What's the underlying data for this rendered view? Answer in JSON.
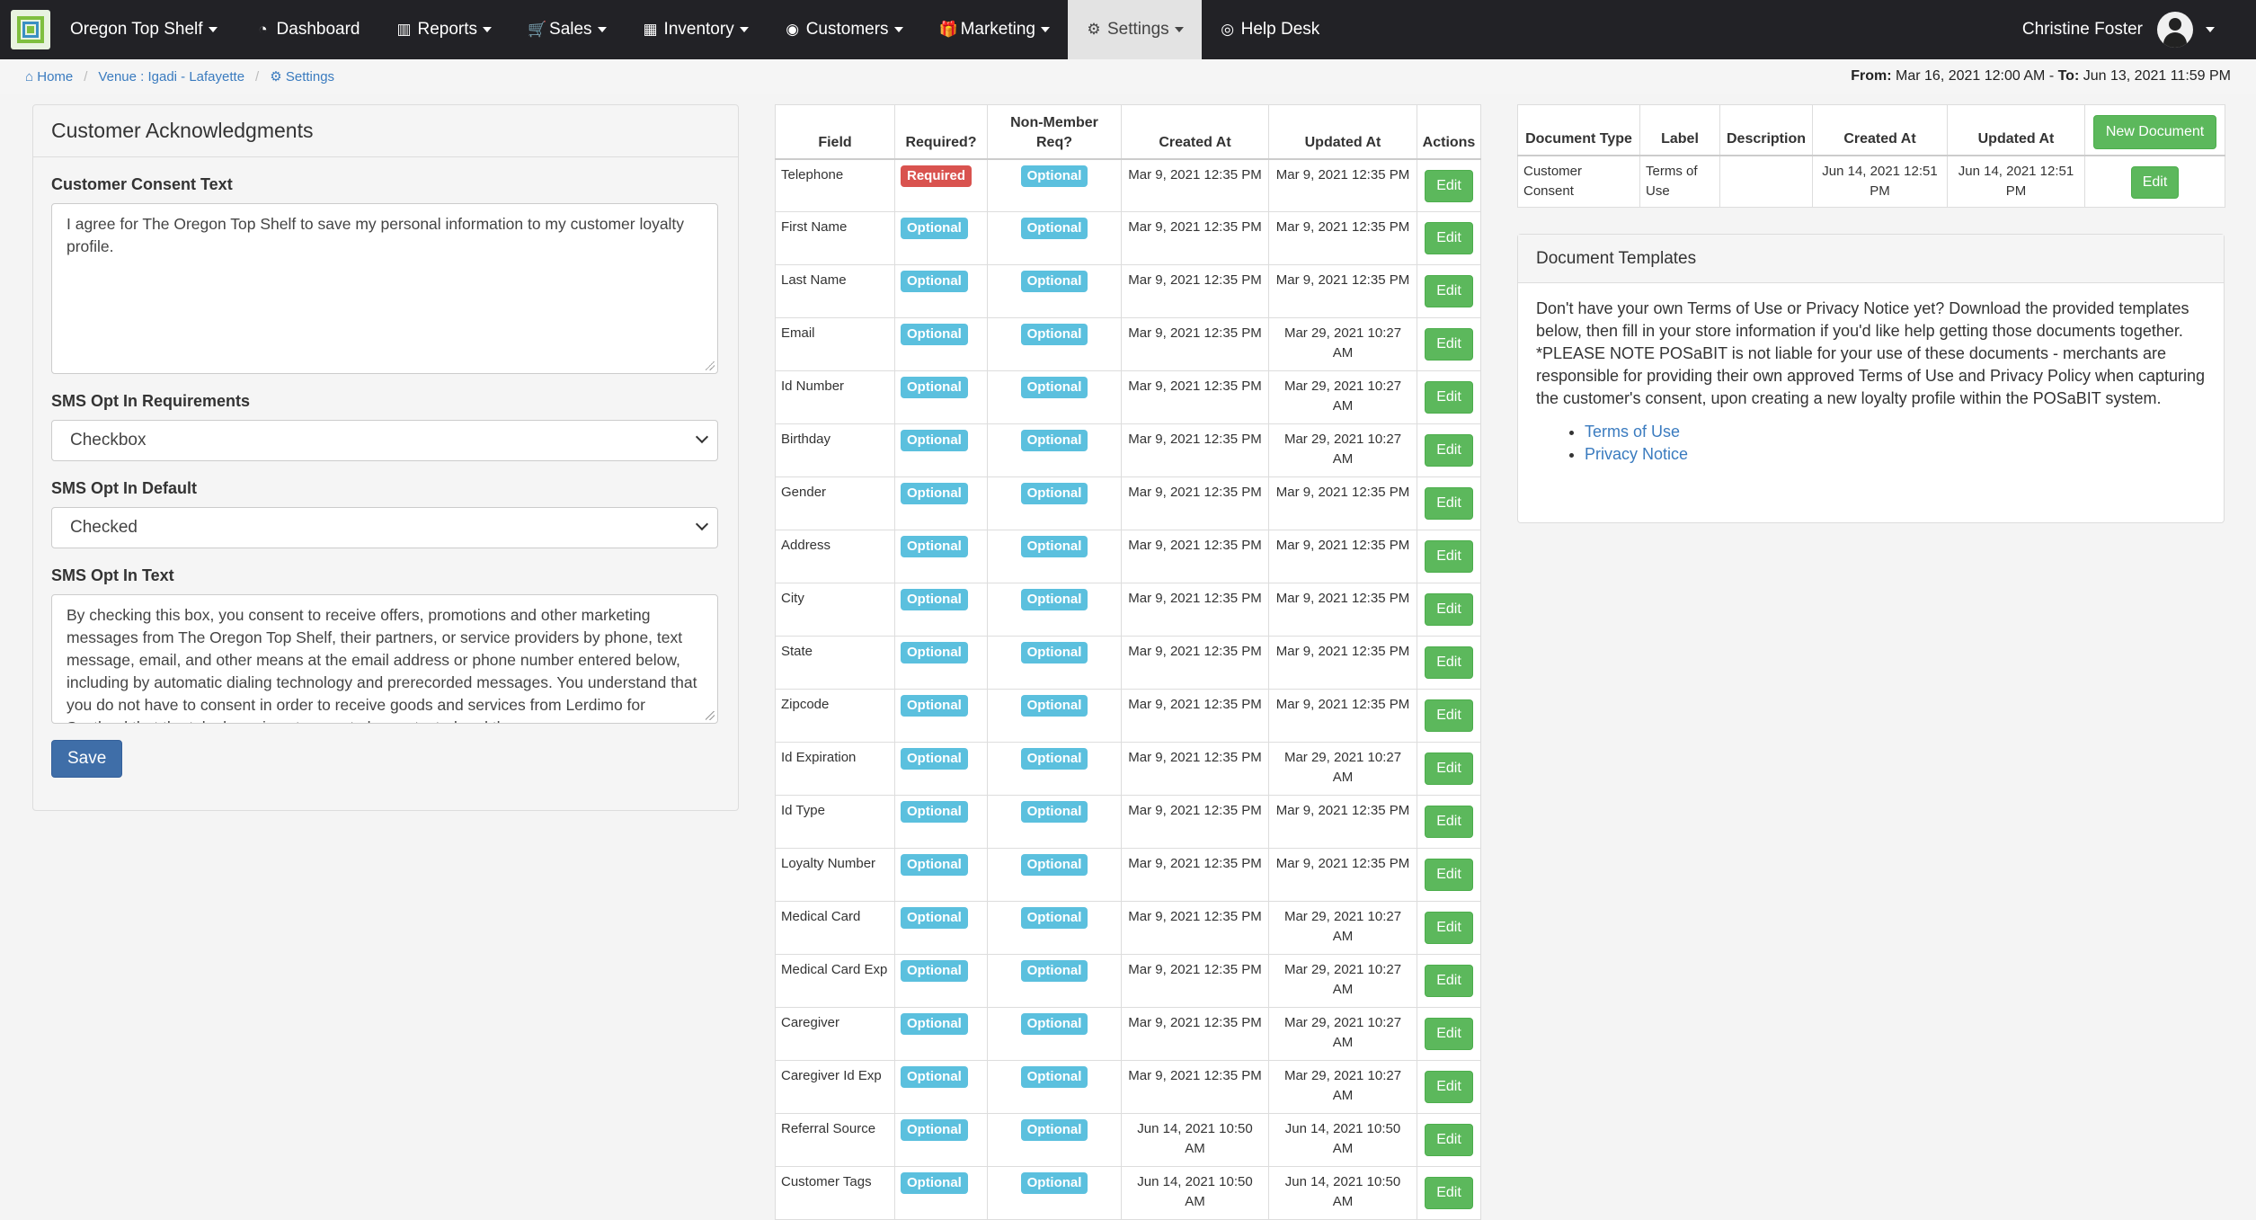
{
  "nav": {
    "brand": "Oregon Top Shelf",
    "items": [
      {
        "label": "Dashboard",
        "icon": "dashboard-icon",
        "glyph": "◔",
        "caret": false,
        "active": false
      },
      {
        "label": "Reports",
        "icon": "bar-chart-icon",
        "glyph": "▥",
        "caret": true,
        "active": false
      },
      {
        "label": "Sales",
        "icon": "cart-icon",
        "glyph": "🛒",
        "caret": true,
        "active": false
      },
      {
        "label": "Inventory",
        "icon": "grid-icon",
        "glyph": "▦",
        "caret": true,
        "active": false
      },
      {
        "label": "Customers",
        "icon": "user-circle-icon",
        "glyph": "◉",
        "caret": true,
        "active": false
      },
      {
        "label": "Marketing",
        "icon": "gift-icon",
        "glyph": "🎁",
        "caret": true,
        "active": false
      },
      {
        "label": "Settings",
        "icon": "cogs-icon",
        "glyph": "⚙",
        "caret": true,
        "active": true
      },
      {
        "label": "Help Desk",
        "icon": "life-ring-icon",
        "glyph": "◎",
        "caret": false,
        "active": false
      }
    ],
    "user": "Christine Foster"
  },
  "breadcrumb": {
    "home": "Home",
    "venue": "Venue : Igadi - Lafayette",
    "settings": "Settings"
  },
  "daterange": {
    "from_label": "From:",
    "from": "Mar 16, 2021 12:00 AM",
    "sep": "-",
    "to_label": "To:",
    "to": "Jun 13, 2021 11:59 PM"
  },
  "ack": {
    "title": "Customer Acknowledgments",
    "consent_label": "Customer Consent Text",
    "consent_text": "I agree for The Oregon Top Shelf to save my personal information to my customer loyalty profile.",
    "sms_req_label": "SMS Opt In Requirements",
    "sms_req_value": "Checkbox",
    "sms_default_label": "SMS Opt In Default",
    "sms_default_value": "Checked",
    "sms_text_label": "SMS Opt In Text",
    "sms_text": "By checking this box, you consent to receive offers, promotions and other marketing messages from The Oregon Top Shelf, their partners, or service providers by phone, text message, email, and other means at the email address or phone number entered below, including by automatic dialing technology and prerecorded messages. You understand that you do not have to consent in order to receive goods and services from Lerdimo for Scotland that the telephone is not a way to be contacted and the",
    "save_label": "Save"
  },
  "fields_table": {
    "headers": [
      "Field",
      "Required?",
      "Non-Member Req?",
      "Created At",
      "Updated At",
      "Actions"
    ],
    "edit_label": "Edit",
    "rows": [
      {
        "field": "Telephone",
        "required": "Required",
        "nonmember": "Optional",
        "created": "Mar 9, 2021 12:35 PM",
        "updated": "Mar 9, 2021 12:35 PM"
      },
      {
        "field": "First Name",
        "required": "Optional",
        "nonmember": "Optional",
        "created": "Mar 9, 2021 12:35 PM",
        "updated": "Mar 9, 2021 12:35 PM"
      },
      {
        "field": "Last Name",
        "required": "Optional",
        "nonmember": "Optional",
        "created": "Mar 9, 2021 12:35 PM",
        "updated": "Mar 9, 2021 12:35 PM"
      },
      {
        "field": "Email",
        "required": "Optional",
        "nonmember": "Optional",
        "created": "Mar 9, 2021 12:35 PM",
        "updated": "Mar 29, 2021 10:27 AM"
      },
      {
        "field": "Id Number",
        "required": "Optional",
        "nonmember": "Optional",
        "created": "Mar 9, 2021 12:35 PM",
        "updated": "Mar 29, 2021 10:27 AM"
      },
      {
        "field": "Birthday",
        "required": "Optional",
        "nonmember": "Optional",
        "created": "Mar 9, 2021 12:35 PM",
        "updated": "Mar 29, 2021 10:27 AM"
      },
      {
        "field": "Gender",
        "required": "Optional",
        "nonmember": "Optional",
        "created": "Mar 9, 2021 12:35 PM",
        "updated": "Mar 9, 2021 12:35 PM"
      },
      {
        "field": "Address",
        "required": "Optional",
        "nonmember": "Optional",
        "created": "Mar 9, 2021 12:35 PM",
        "updated": "Mar 9, 2021 12:35 PM"
      },
      {
        "field": "City",
        "required": "Optional",
        "nonmember": "Optional",
        "created": "Mar 9, 2021 12:35 PM",
        "updated": "Mar 9, 2021 12:35 PM"
      },
      {
        "field": "State",
        "required": "Optional",
        "nonmember": "Optional",
        "created": "Mar 9, 2021 12:35 PM",
        "updated": "Mar 9, 2021 12:35 PM"
      },
      {
        "field": "Zipcode",
        "required": "Optional",
        "nonmember": "Optional",
        "created": "Mar 9, 2021 12:35 PM",
        "updated": "Mar 9, 2021 12:35 PM"
      },
      {
        "field": "Id Expiration",
        "required": "Optional",
        "nonmember": "Optional",
        "created": "Mar 9, 2021 12:35 PM",
        "updated": "Mar 29, 2021 10:27 AM"
      },
      {
        "field": "Id Type",
        "required": "Optional",
        "nonmember": "Optional",
        "created": "Mar 9, 2021 12:35 PM",
        "updated": "Mar 9, 2021 12:35 PM"
      },
      {
        "field": "Loyalty Number",
        "required": "Optional",
        "nonmember": "Optional",
        "created": "Mar 9, 2021 12:35 PM",
        "updated": "Mar 9, 2021 12:35 PM"
      },
      {
        "field": "Medical Card",
        "required": "Optional",
        "nonmember": "Optional",
        "created": "Mar 9, 2021 12:35 PM",
        "updated": "Mar 29, 2021 10:27 AM"
      },
      {
        "field": "Medical Card Exp",
        "required": "Optional",
        "nonmember": "Optional",
        "created": "Mar 9, 2021 12:35 PM",
        "updated": "Mar 29, 2021 10:27 AM"
      },
      {
        "field": "Caregiver",
        "required": "Optional",
        "nonmember": "Optional",
        "created": "Mar 9, 2021 12:35 PM",
        "updated": "Mar 29, 2021 10:27 AM"
      },
      {
        "field": "Caregiver Id Exp",
        "required": "Optional",
        "nonmember": "Optional",
        "created": "Mar 9, 2021 12:35 PM",
        "updated": "Mar 29, 2021 10:27 AM"
      },
      {
        "field": "Referral Source",
        "required": "Optional",
        "nonmember": "Optional",
        "created": "Jun 14, 2021 10:50 AM",
        "updated": "Jun 14, 2021 10:50 AM"
      },
      {
        "field": "Customer Tags",
        "required": "Optional",
        "nonmember": "Optional",
        "created": "Jun 14, 2021 10:50 AM",
        "updated": "Jun 14, 2021 10:50 AM"
      }
    ]
  },
  "documents": {
    "headers": [
      "Document Type",
      "Label",
      "Description",
      "Created At",
      "Updated At"
    ],
    "new_label": "New Document",
    "edit_label": "Edit",
    "rows": [
      {
        "type": "Customer Consent",
        "label": "Terms of Use",
        "description": "",
        "created": "Jun 14, 2021 12:51 PM",
        "updated": "Jun 14, 2021 12:51 PM"
      }
    ]
  },
  "templates": {
    "title": "Document Templates",
    "body": "Don't have your own Terms of Use or Privacy Notice yet? Download the provided templates below, then fill in your store information if you'd like help getting those documents together. *PLEASE NOTE POSaBIT is not liable for your use of these documents - merchants are responsible for providing their own approved Terms of Use and Privacy Policy when capturing the customer's consent, upon creating a new loyalty profile within the POSaBIT system.",
    "links": [
      "Terms of Use",
      "Privacy Notice"
    ]
  },
  "colors": {
    "navbar": "#222226",
    "link": "#3a7bbf",
    "optional": "#5bc0de",
    "required": "#d9534f",
    "success": "#5cb85c",
    "primary": "#3f6ea8"
  }
}
